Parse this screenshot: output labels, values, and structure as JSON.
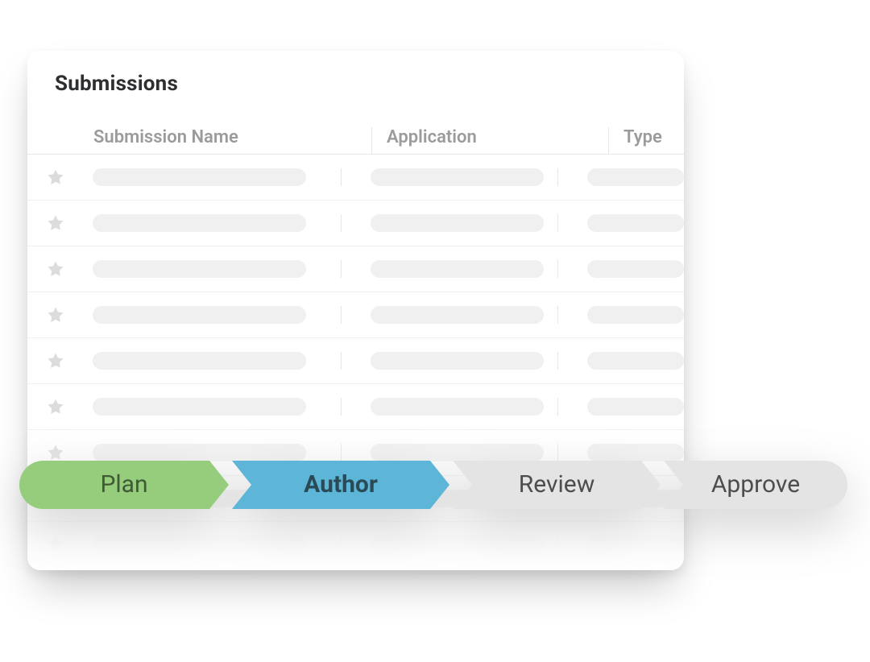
{
  "card": {
    "title": "Submissions"
  },
  "table": {
    "columns": {
      "submission_name": "Submission Name",
      "application": "Application",
      "type": "Type"
    },
    "row_count": 9
  },
  "stages": {
    "items": [
      {
        "label": "Plan",
        "state": "done"
      },
      {
        "label": "Author",
        "state": "active"
      },
      {
        "label": "Review",
        "state": "upcoming"
      },
      {
        "label": "Approve",
        "state": "upcoming"
      }
    ]
  },
  "colors": {
    "stage_done": "#95cd7c",
    "stage_active": "#5db6d8",
    "stage_idle": "#e4e4e4"
  }
}
